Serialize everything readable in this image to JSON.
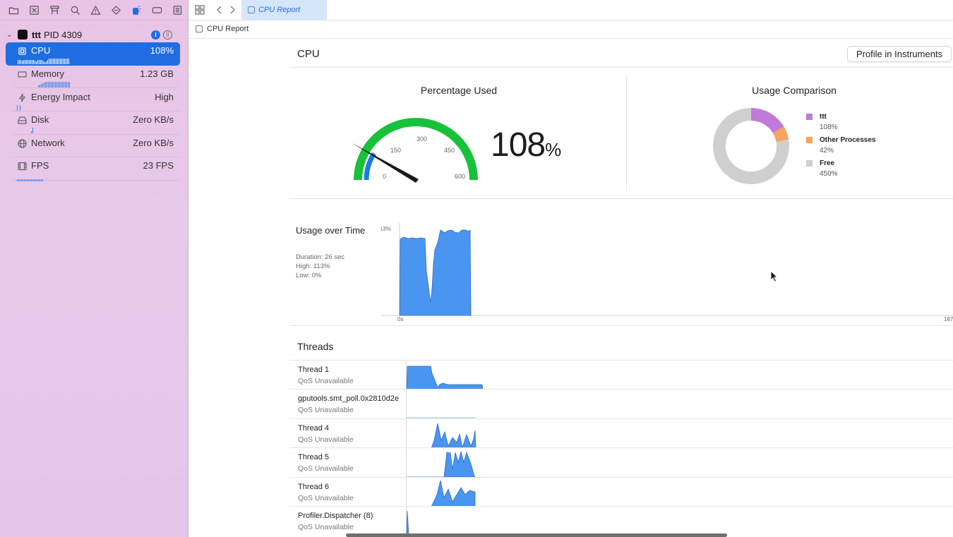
{
  "sidebar": {
    "toolbar_icons": [
      "folder-icon",
      "close-square-icon",
      "hierarchy-icon",
      "search-icon",
      "warning-icon",
      "breakpoint-icon",
      "debug-gauge-icon",
      "label-icon",
      "report-icon"
    ],
    "process": {
      "name": "ttt",
      "pid": "PID 4309"
    },
    "gauges": [
      {
        "label": "CPU",
        "value": "108%",
        "icon": "cpu-icon",
        "selected": true
      },
      {
        "label": "Memory",
        "value": "1.23 GB",
        "icon": "memory-icon"
      },
      {
        "label": "Energy Impact",
        "value": "High",
        "icon": "bolt-icon"
      },
      {
        "label": "Disk",
        "value": "Zero KB/s",
        "icon": "disk-icon"
      },
      {
        "label": "Network",
        "value": "Zero KB/s",
        "icon": "globe-icon"
      },
      {
        "label": "FPS",
        "value": "23 FPS",
        "icon": "film-icon"
      }
    ]
  },
  "tabs": {
    "active": "CPU Report"
  },
  "breadcrumb": {
    "label": "CPU Report"
  },
  "report": {
    "title": "CPU",
    "profile_button": "Profile in Instruments",
    "percentage_used": {
      "title": "Percentage Used",
      "value": "108",
      "unit": "%",
      "gauge_ticks": [
        "0",
        "150",
        "300",
        "450",
        "600"
      ],
      "gauge_value": 108,
      "gauge_max": 600
    },
    "usage_comparison": {
      "title": "Usage Comparison",
      "legend": [
        {
          "name": "ttt",
          "value": "108%",
          "color": "#c07ad9"
        },
        {
          "name": "Other Processes",
          "value": "42%",
          "color": "#f6a45e"
        },
        {
          "name": "Free",
          "value": "450%",
          "color": "#cfcfcf"
        }
      ]
    },
    "usage_over_time": {
      "title": "Usage over Time",
      "duration": "Duration: 26 sec",
      "high": "High: 113%",
      "low": "Low: 0%",
      "y_max_label": "113%",
      "x_start_label": "0s",
      "x_end_label": "187"
    },
    "threads": {
      "title": "Threads",
      "rows": [
        {
          "name": "Thread 1",
          "qos": "QoS Unavailable"
        },
        {
          "name": "gputools.smt_poll.0x2810d2e",
          "qos": "QoS Unavailable"
        },
        {
          "name": "Thread 4",
          "qos": "QoS Unavailable"
        },
        {
          "name": "Thread 5",
          "qos": "QoS Unavailable"
        },
        {
          "name": "Thread 6",
          "qos": "QoS Unavailable"
        },
        {
          "name": "Profiler.Dispatcher (8)",
          "qos": "QoS Unavailable"
        }
      ]
    }
  },
  "colors": {
    "accent": "#1f6de0",
    "gauge_green": "#18c13a",
    "chart_blue": "#4a95f0"
  }
}
